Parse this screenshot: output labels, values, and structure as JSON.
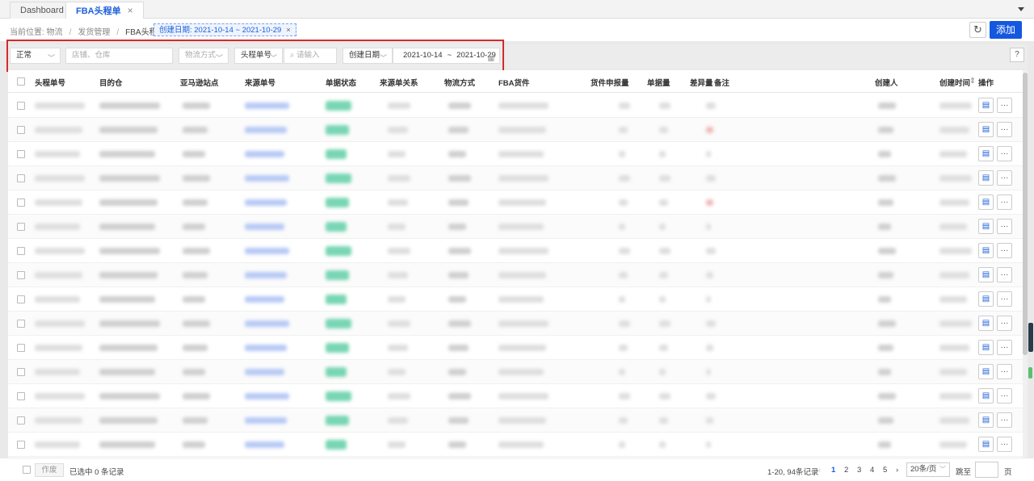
{
  "tabs": [
    {
      "label": "Dashboard",
      "active": false
    },
    {
      "label": "FBA头程单",
      "active": true
    }
  ],
  "breadcrumb": {
    "prefix": "当前位置: 物流",
    "sep": "/",
    "items": [
      "发货管理",
      "FBA头程单"
    ]
  },
  "date_chip": "创建日期: 2021-10-14 ~ 2021-10-29",
  "buttons": {
    "add": "添加",
    "help": "?",
    "batch": "作废"
  },
  "filters": {
    "status": "正常",
    "shop_placeholder": "店铺、仓库",
    "logistics_placeholder": "物流方式",
    "number_type": "头程单号",
    "search_placeholder": "请输入",
    "date_type": "创建日期",
    "date_start": "2021-10-14",
    "date_sep": "~",
    "date_end": "2021-10-29"
  },
  "table": {
    "columns": [
      "头程单号",
      "目的仓",
      "亚马逊站点",
      "来源单号",
      "单据状态",
      "来源单关系",
      "物流方式",
      "FBA货件",
      "货件申报量",
      "单据量",
      "差异量",
      "备注",
      "创建人",
      "创建时间",
      "操作"
    ],
    "row_count": 15
  },
  "footer": {
    "selected": "已选中 0 条记录",
    "range": "1-20, 94条记录",
    "pages": [
      "1",
      "2",
      "3",
      "4",
      "5"
    ],
    "current_page": "1",
    "page_size": "20条/页",
    "jump_label": "跳至",
    "page_unit": "页"
  },
  "colors": {
    "accent": "#1558e0",
    "highlight_border": "#d62a2a",
    "status_green": "#78d6b4"
  }
}
